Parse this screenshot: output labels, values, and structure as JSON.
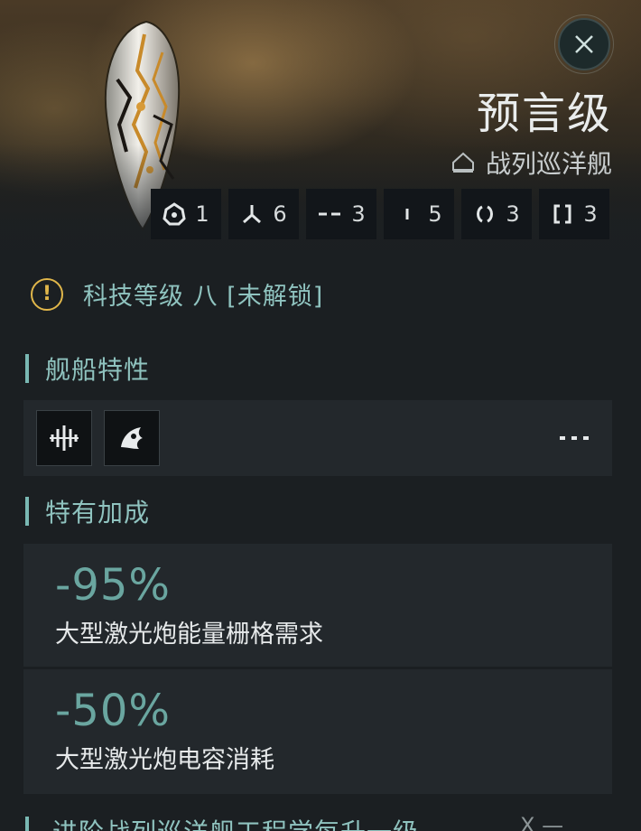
{
  "ship": {
    "name": "预言级",
    "class": "战列巡洋舰"
  },
  "slots": [
    {
      "icon": "drone-bay-icon",
      "value": "1"
    },
    {
      "icon": "high-slot-icon",
      "value": "6"
    },
    {
      "icon": "mid-slot-icon",
      "value": "3"
    },
    {
      "icon": "low-slot-icon",
      "value": "5"
    },
    {
      "icon": "rig-slot-icon",
      "value": "3"
    },
    {
      "icon": "subsystem-slot-icon",
      "value": "3"
    }
  ],
  "tech_level": {
    "text": "科技等级 八 [未解锁]"
  },
  "sections": {
    "traits": "舰船特性",
    "bonuses": "特有加成"
  },
  "bonuses": [
    {
      "value": "-95%",
      "description": "大型激光炮能量栅格需求"
    },
    {
      "value": "-50%",
      "description": "大型激光炮电容消耗"
    }
  ],
  "next_section": {
    "text": "进阶战列巡洋舰工程学每升一级",
    "right_text": "X —"
  },
  "colors": {
    "accent": "#8fc3bf",
    "value": "#6aa6a0",
    "warning": "#e0b64a"
  }
}
